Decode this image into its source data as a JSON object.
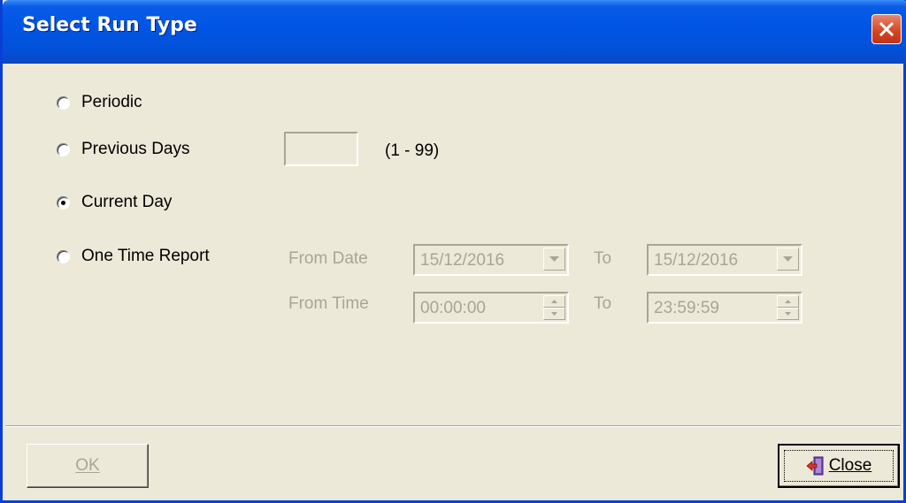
{
  "window": {
    "title": "Select Run Type",
    "title_color": "#0055e5",
    "close_icon": "close-icon"
  },
  "options": {
    "periodic": {
      "label": "Periodic",
      "selected": false
    },
    "previous_days": {
      "label": "Previous Days",
      "selected": false,
      "value": "",
      "range_hint": "(1 - 99)"
    },
    "current_day": {
      "label": "Current Day",
      "selected": true
    },
    "one_time_report": {
      "label": "One Time Report",
      "selected": false
    }
  },
  "date_range": {
    "from_date_label": "From Date",
    "from_date_value": "15/12/2016",
    "to_date_label": "To",
    "to_date_value": "15/12/2016",
    "from_time_label": "From Time",
    "from_time_value": "00:00:00",
    "to_time_label": "To",
    "to_time_value": "23:59:59",
    "enabled": false
  },
  "buttons": {
    "ok_label": "OK",
    "ok_enabled": false,
    "close_label": "Close",
    "close_icon": "exit-door-icon"
  }
}
